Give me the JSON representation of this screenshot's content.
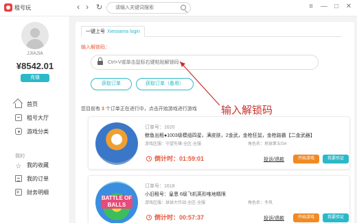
{
  "app": {
    "name": "租号玩",
    "search_placeholder": "请输入关键词搜索"
  },
  "window_controls": {
    "menu": "≡",
    "minimize": "—",
    "maximize": "□",
    "close": "✕"
  },
  "sidebar": {
    "username": "JJIAJIA",
    "balance": "¥8542.01",
    "recharge_label": "充值",
    "nav_items": [
      {
        "label": "首页",
        "icon": "home-icon"
      },
      {
        "label": "租号大厅",
        "icon": "rent-hall-icon"
      },
      {
        "label": "游戏分类",
        "icon": "category-icon"
      }
    ],
    "section_label": "我的",
    "my_items": [
      {
        "label": "我的收藏",
        "icon": "star-icon"
      },
      {
        "label": "我的订单",
        "icon": "order-icon"
      },
      {
        "label": "财务明细",
        "icon": "finance-icon"
      }
    ]
  },
  "login": {
    "tab_label": "一键上号",
    "tab_sub": "Xiesoama login",
    "code_label": "输入解锁码：",
    "code_placeholder": "Ctrl+V或单击鼠标右键粘贴解锁码",
    "get_order_label": "获取订单",
    "get_order_backup_label": "获取订单（备用）"
  },
  "summary": {
    "prefix": "您目前有",
    "count": "3",
    "suffix": "个订单正在进行中，点击开始游戏进行游戏"
  },
  "annotation": "输入解锁码",
  "orders": [
    {
      "order_no": "订单号：1620",
      "title": "鲸鱼出租●1003级模组四星，满皮肤，2金武，金枪狂鼠，金枪路霸【二金武器】",
      "area": "游戏区服：守望先锋-全区-全服",
      "role": "角色名：地球第五f34",
      "countdown": "倒计时：01:59:01",
      "renew": "投诉/退款",
      "start": "开始游戏",
      "verify": "我要验证"
    },
    {
      "order_no": "订单号：1618",
      "title": "小旧租号：皇恩 6级飞机英形唯地精限",
      "area": "游戏区服：球球大作战-全区-全服",
      "role": "角色名：予风",
      "countdown": "倒计时：00:57:37",
      "renew": "投诉/退款",
      "start": "开始游戏",
      "verify": "我要验证",
      "badge": "BATTLE OF BALLS"
    }
  ]
}
